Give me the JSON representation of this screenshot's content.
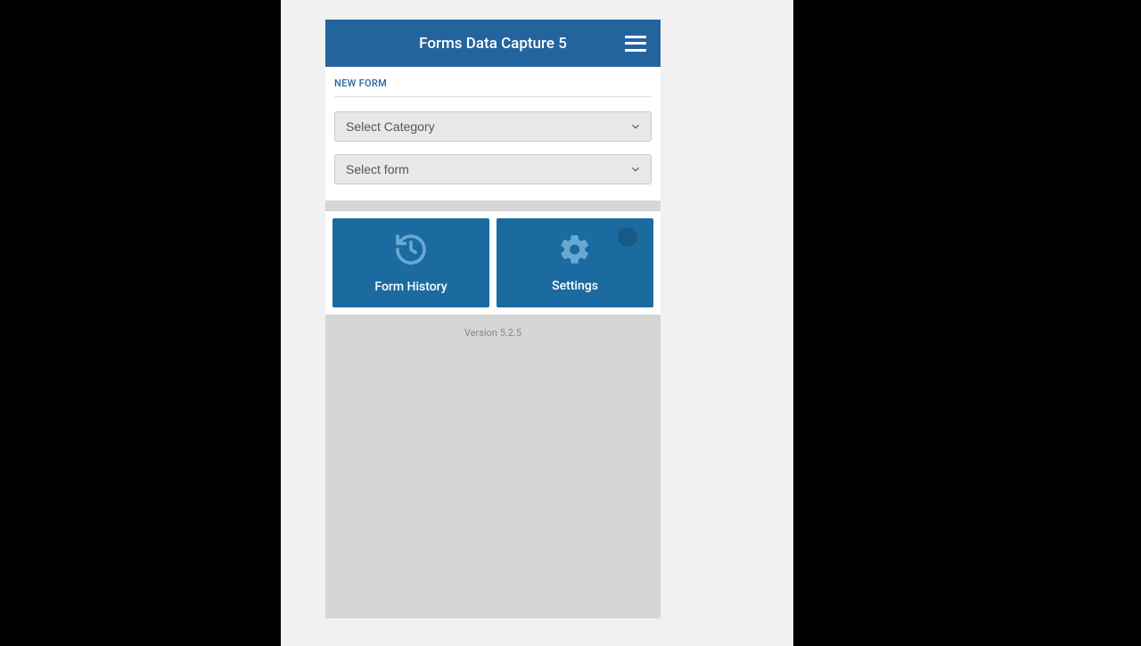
{
  "header": {
    "title": "Forms Data Capture 5"
  },
  "newForm": {
    "label": "NEW FORM",
    "categoryPlaceholder": "Select Category",
    "formPlaceholder": "Select form"
  },
  "tiles": {
    "history_label": "Form History",
    "settings_label": "Settings"
  },
  "footer": {
    "version": "Version 5.2.5"
  }
}
